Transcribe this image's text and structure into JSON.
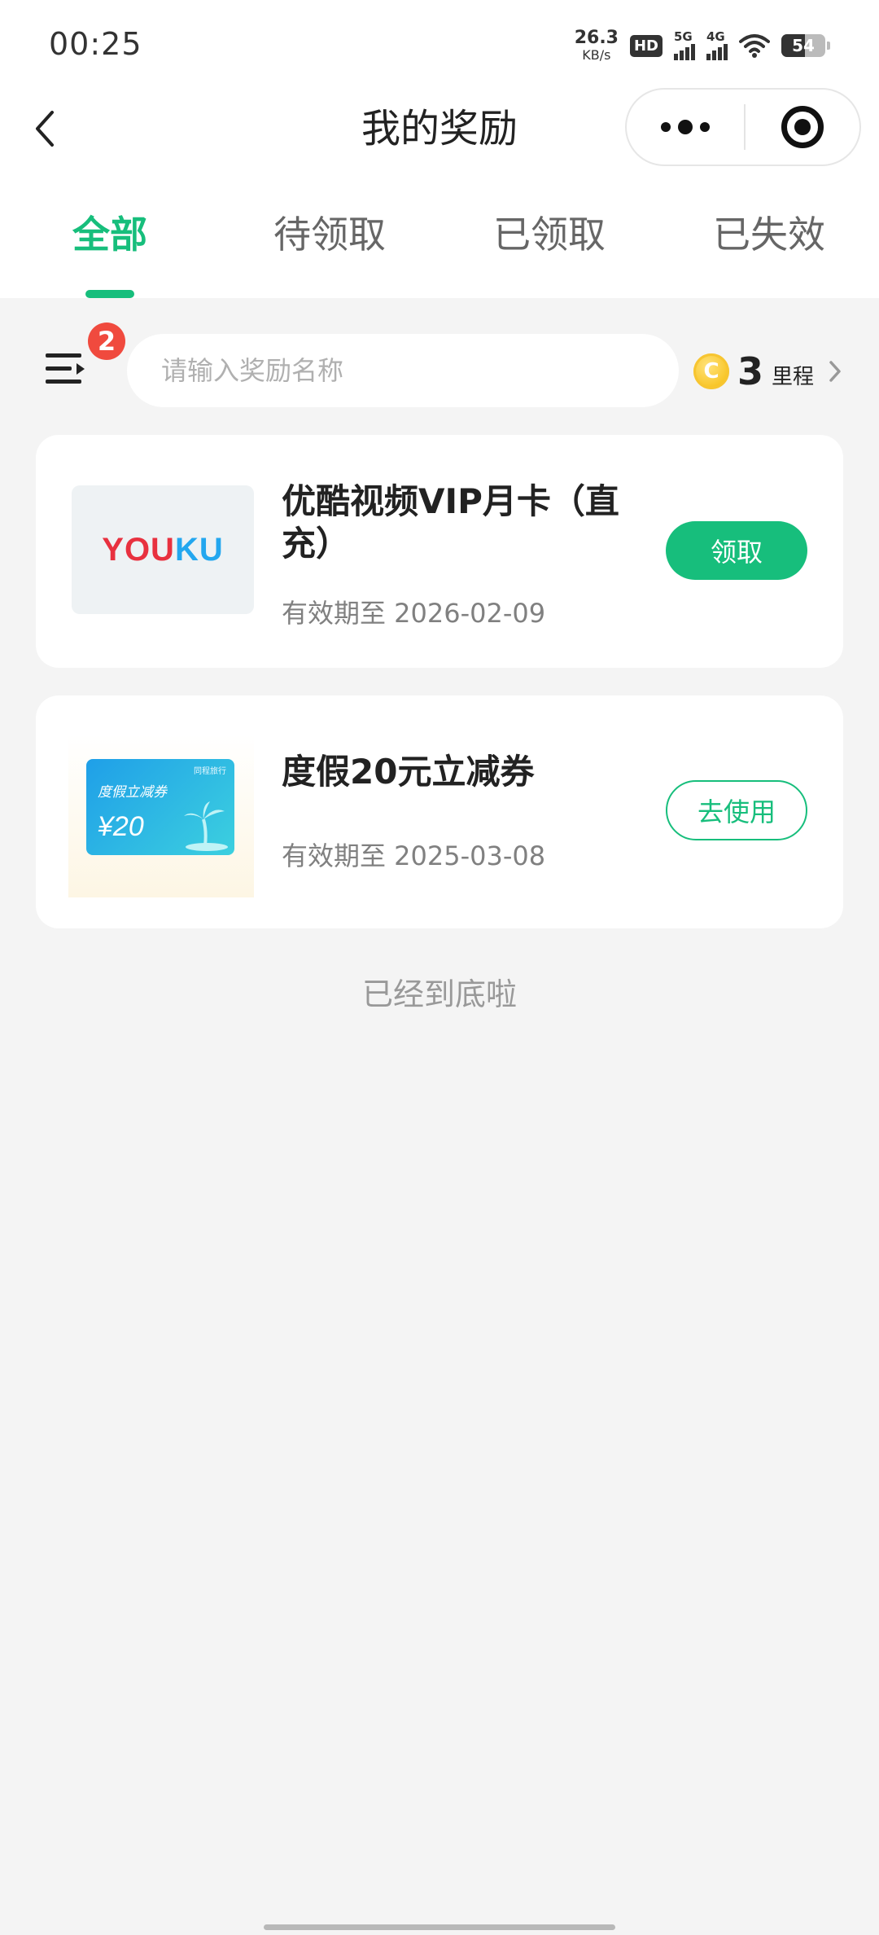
{
  "status_bar": {
    "time": "00:25",
    "net_speed_value": "26.3",
    "net_speed_unit": "KB/s",
    "hd_label": "HD",
    "sim1_label": "5G",
    "sim2_label": "4G",
    "battery": "54"
  },
  "nav": {
    "title": "我的奖励",
    "back_icon": "chevron-left-icon",
    "more_icon": "more-dots-icon",
    "close_icon": "target-circle-icon"
  },
  "tabs": [
    {
      "label": "全部",
      "active": true
    },
    {
      "label": "待领取",
      "active": false
    },
    {
      "label": "已领取",
      "active": false
    },
    {
      "label": "已失效",
      "active": false
    }
  ],
  "filter": {
    "badge_count": "2",
    "search_placeholder": "请输入奖励名称",
    "coin_symbol": "C",
    "miles_count": "3",
    "miles_unit": "里程"
  },
  "rewards": [
    {
      "logo_text_red": "YOU",
      "logo_text_blue": "KU",
      "title": "优酷视频VIP月卡（直充）",
      "expiry": "有效期至 2026-02-09",
      "action": "领取"
    },
    {
      "thumb_brand": "同程旅行",
      "thumb_name": "度假立减券",
      "thumb_amount": "¥20",
      "title": "度假20元立减券",
      "expiry": "有效期至 2025-03-08",
      "action": "去使用"
    }
  ],
  "footer": {
    "end_text": "已经到底啦"
  },
  "colors": {
    "accent": "#17be7c",
    "badge": "#f04a3e",
    "background": "#f4f4f4"
  }
}
